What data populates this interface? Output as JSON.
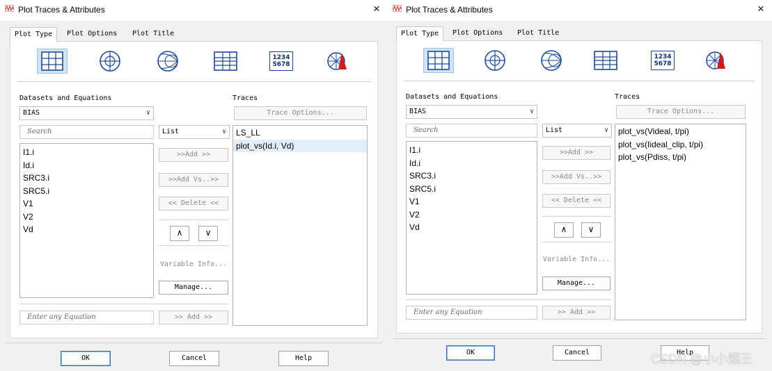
{
  "watermark": "CSDN @小小烟王",
  "colors": {
    "selected_icon_bg": "#cfe4f7",
    "list_selection": "#e2eefa",
    "default_button_border": "#2f6fba"
  },
  "dialogs": [
    {
      "title": "Plot Traces & Attributes",
      "close_glyph": "×",
      "tabs": [
        "Plot Type",
        "Plot Options",
        "Plot Title"
      ],
      "plot_type_icons": [
        "rectangular-plot-icon",
        "polar-plot-icon",
        "smith-chart-icon",
        "list-table-icon",
        "tabular-data-icon",
        "antenna-plot-icon"
      ],
      "tabular_icon_text": [
        "1234",
        "5678"
      ],
      "datasets_label": "Datasets and Equations",
      "dataset": "BIAS",
      "search_placeholder": "Search",
      "variables": [
        "I1.i",
        "Id.i",
        "SRC3.i",
        "SRC5.i",
        "V1",
        "V2",
        "Vd"
      ],
      "view_mode": "List",
      "add_button": ">>Add >>",
      "add_vs_button": ">>Add Vs..>>",
      "delete_button": "<< Delete <<",
      "move_up_glyph": "∧",
      "move_down_glyph": "∨",
      "variable_info_button": "Variable Info...",
      "manage_button": "Manage...",
      "equation_placeholder": "Enter any Equation",
      "equation_add_button": ">> Add >>",
      "traces_label": "Traces",
      "trace_options_button": "Trace Options...",
      "traces": [
        "LS_LL",
        "plot_vs(Id.i, Vd)"
      ],
      "selected_trace_index": 1,
      "ok_button": "OK",
      "cancel_button": "Cancel",
      "help_button": "Help"
    },
    {
      "title": "Plot Traces & Attributes",
      "close_glyph": "×",
      "tabs": [
        "Plot Type",
        "Plot Options",
        "Plot Title"
      ],
      "plot_type_icons": [
        "rectangular-plot-icon",
        "polar-plot-icon",
        "smith-chart-icon",
        "list-table-icon",
        "tabular-data-icon",
        "antenna-plot-icon"
      ],
      "tabular_icon_text": [
        "1234",
        "5678"
      ],
      "datasets_label": "Datasets and Equations",
      "dataset": "BIAS",
      "search_placeholder": "Search",
      "variables": [
        "I1.i",
        "Id.i",
        "SRC3.i",
        "SRC5.i",
        "V1",
        "V2",
        "Vd"
      ],
      "view_mode": "List",
      "add_button": ">>Add >>",
      "add_vs_button": ">>Add Vs..>>",
      "delete_button": "<< Delete <<",
      "move_up_glyph": "∧",
      "move_down_glyph": "∨",
      "variable_info_button": "Variable Info...",
      "manage_button": "Manage...",
      "equation_placeholder": "Enter any Equation",
      "equation_add_button": ">> Add >>",
      "traces_label": "Traces",
      "trace_options_button": "Trace Options...",
      "traces": [
        "plot_vs(Videal, t/pi)",
        "plot_vs(Iideal_clip, t/pi)",
        "plot_vs(Pdiss, t/pi)"
      ],
      "ok_button": "OK",
      "cancel_button": "Cancel",
      "help_button": "Help"
    }
  ]
}
